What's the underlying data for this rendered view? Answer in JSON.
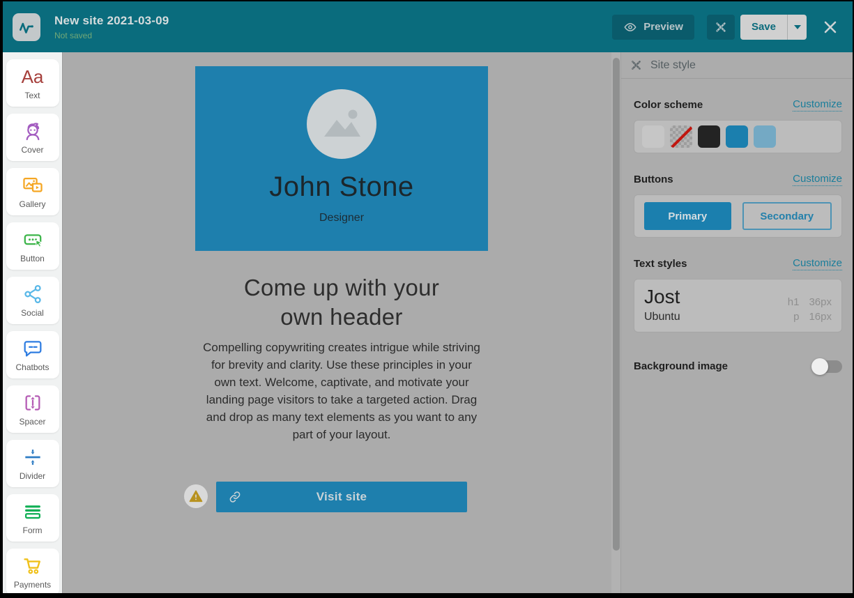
{
  "header": {
    "title": "New site 2021-03-09",
    "status": "Not saved",
    "preview_label": "Preview",
    "save_label": "Save",
    "colors": {
      "bar": "#0a6c7d",
      "button": "#0a5b6b",
      "save_bg": "#d0d0d0",
      "save_text": "#0b6b7c",
      "status_text": "#72a877"
    }
  },
  "sidebar": {
    "items": [
      {
        "label": "Text",
        "icon": "text-icon",
        "glyph": "Aa",
        "color": "#a6403c"
      },
      {
        "label": "Cover",
        "icon": "cover-icon",
        "color": "#a35cc0"
      },
      {
        "label": "Gallery",
        "icon": "gallery-icon",
        "color": "#f5a623"
      },
      {
        "label": "Button",
        "icon": "button-icon",
        "color": "#3db54a"
      },
      {
        "label": "Social",
        "icon": "social-icon",
        "color": "#59b8e8"
      },
      {
        "label": "Chatbots",
        "icon": "chatbots-icon",
        "color": "#2f7de1"
      },
      {
        "label": "Spacer",
        "icon": "spacer-icon",
        "color": "#b55cb5"
      },
      {
        "label": "Divider",
        "icon": "divider-icon",
        "color": "#2e7cc4"
      },
      {
        "label": "Form",
        "icon": "form-icon",
        "color": "#0faf54"
      },
      {
        "label": "Payments",
        "icicon": "payments-icon",
        "icon": "payments-icon",
        "color": "#f0c11a"
      }
    ]
  },
  "canvas": {
    "cover": {
      "name": "John Stone",
      "role": "Designer",
      "background": "#1e7fad"
    },
    "heading": "Come up with your own header",
    "body": "Compelling copywriting creates intrigue while striving for brevity and clarity. Use these principles in your own text. Welcome, captivate, and motivate your landing page visitors to take a targeted action. Drag and drop as many text elements as you want to any part of your layout.",
    "visit_button": {
      "label": "Visit site",
      "background": "#1e7fad"
    }
  },
  "style_panel": {
    "title": "Site style",
    "color_scheme": {
      "label": "Color scheme",
      "customize": "Customize",
      "swatches": [
        {
          "name": "gray",
          "color": "#c6c6c6"
        },
        {
          "name": "transparent-none",
          "color": "transparent"
        },
        {
          "name": "black",
          "color": "#232323"
        },
        {
          "name": "blue",
          "color": "#1b7fae"
        },
        {
          "name": "light-blue",
          "color": "#74a9c4"
        }
      ]
    },
    "buttons": {
      "label": "Buttons",
      "customize": "Customize",
      "primary": "Primary",
      "secondary": "Secondary"
    },
    "text_styles": {
      "label": "Text styles",
      "customize": "Customize",
      "rows": [
        {
          "font": "Jost",
          "tag": "h1",
          "size": "36px"
        },
        {
          "font": "Ubuntu",
          "tag": "p",
          "size": "16px"
        }
      ]
    },
    "background_image": {
      "label": "Background image",
      "state": "off"
    },
    "accent": "#1b7e9b"
  }
}
